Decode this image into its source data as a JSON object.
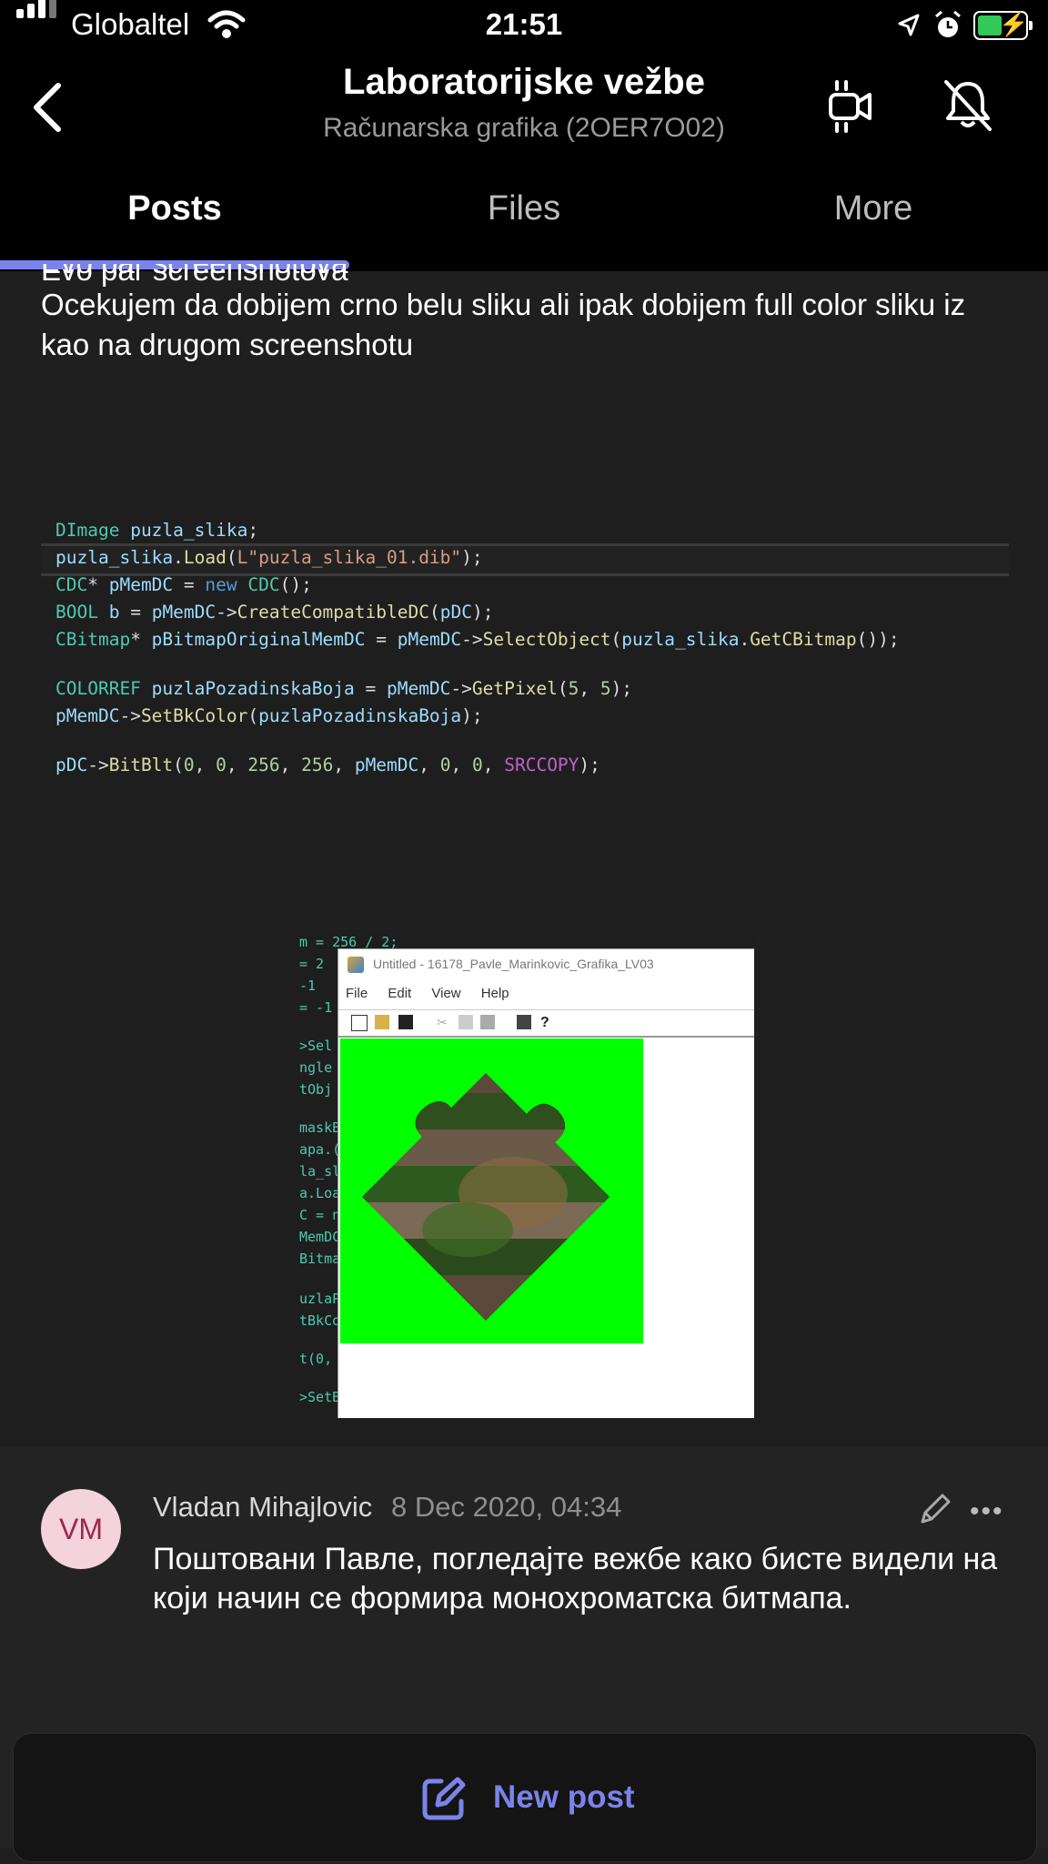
{
  "status_bar": {
    "carrier": "Globaltel",
    "time": "21:51"
  },
  "header": {
    "title": "Laboratorijske vežbe",
    "subtitle": "Računarska grafika (2OER7O02)",
    "tabs": [
      "Posts",
      "Files",
      "More"
    ]
  },
  "post": {
    "partial_line": "Evo par screenshotova",
    "text": "Ocekujem da dobijem crno belu sliku ali ipak dobijem full color sliku iz kao na drugom screenshotu"
  },
  "code_lines": [
    "DImage puzla_slika;",
    "puzla_slika.Load(L\"puzla_slika_01.dib\");",
    "CDC* pMemDC = new CDC();",
    "BOOL b = pMemDC->CreateCompatibleDC(pDC);",
    "CBitmap* pBitmapOriginalMemDC = pMemDC->SelectObject(puzla_slika.GetCBitmap());",
    "COLORREF puzlaPozadinskaBoja = pMemDC->GetPixel(5, 5);",
    "pMemDC->SetBkColor(puzlaPozadinskaBoja);",
    "pDC->BitBlt(0, 0, 256, 256, pMemDC, 0, 0, SRCCOPY);"
  ],
  "screenshot": {
    "window_title": "Untitled - 16178_Pavle_Marinkovic_Grafika_LV03",
    "menu": [
      "File",
      "Edit",
      "View",
      "Help"
    ],
    "code_fragments": [
      "m = 256 / 2;",
      "= 2",
      "-1",
      "= -1",
      ">Sel",
      "ngle",
      "tObj",
      "maskB",
      "apa.(",
      "la_sl",
      "a.Loa",
      "C = n",
      "MemDC",
      "Bitma",
      "uzlaP",
      "tBkCo",
      "t(0,",
      ">SetB"
    ]
  },
  "reply": {
    "initials": "VM",
    "author": "Vladan Mihajlovic",
    "date": "8 Dec 2020, 04:34",
    "text": "Поштовани Павле, погледајте вежбе како бисте видели на који начин се формира монохроматска битмапа."
  },
  "new_post_label": "New post",
  "colors": {
    "accent": "#7b83eb",
    "background": "#1f1f1f",
    "avatar_bg": "#f4d3dc",
    "avatar_fg": "#9b2850"
  }
}
